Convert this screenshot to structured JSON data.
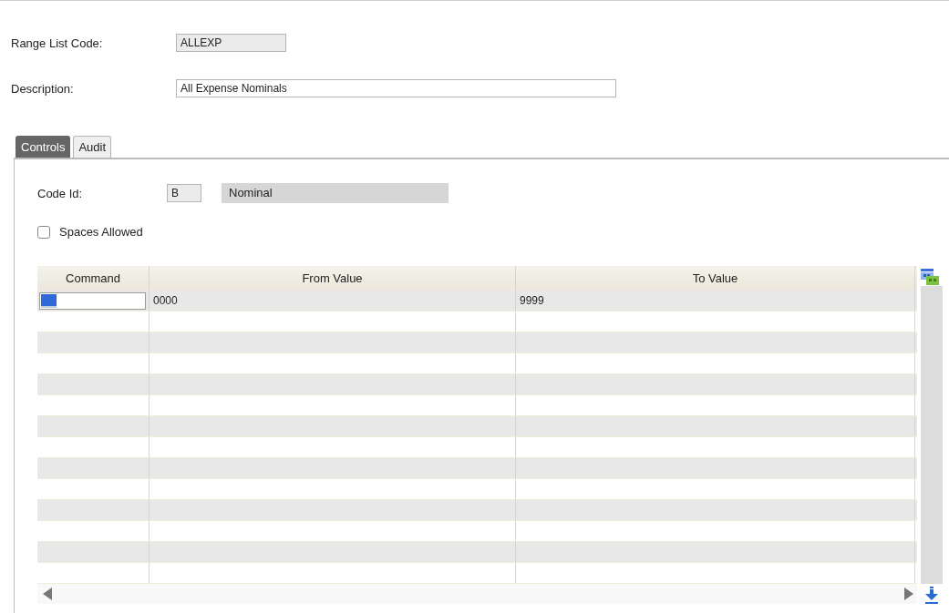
{
  "fields": [
    {
      "label": "Range List Code:",
      "value": "ALLEXP",
      "kind": "short"
    },
    {
      "label": "Description:",
      "value": "All Expense Nominals",
      "kind": "long"
    }
  ],
  "tabs": [
    {
      "label": "Controls",
      "selected": true
    },
    {
      "label": "Audit",
      "selected": false
    }
  ],
  "code_id": {
    "label": "Code Id:",
    "value": "B",
    "name": "Nominal"
  },
  "spaces_allowed": {
    "label": "Spaces Allowed",
    "checked": false
  },
  "table": {
    "columns": [
      "Command",
      "From Value",
      "To Value"
    ],
    "rows": [
      {
        "command": "",
        "from": "0000",
        "to": "9999",
        "selected": true
      }
    ]
  }
}
